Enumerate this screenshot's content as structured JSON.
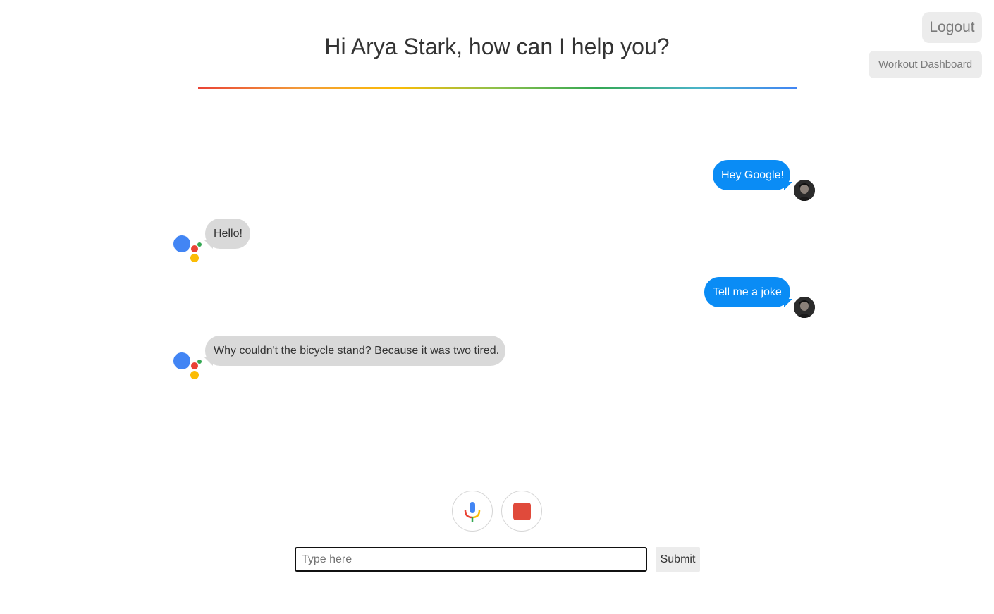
{
  "header": {
    "greeting": "Hi Arya Stark, how can I help you?",
    "logout_label": "Logout",
    "dashboard_label": "Workout Dashboard"
  },
  "messages": [
    {
      "sender": "user",
      "text": "Hey Google!"
    },
    {
      "sender": "assistant",
      "text": "Hello!"
    },
    {
      "sender": "user",
      "text": "Tell me a joke"
    },
    {
      "sender": "assistant",
      "text": "Why couldn't the bicycle stand? Because it was two tired."
    }
  ],
  "controls": {
    "mic_icon": "microphone-icon",
    "stop_icon": "stop-icon"
  },
  "input": {
    "placeholder": "Type here",
    "value": "",
    "submit_label": "Submit"
  },
  "colors": {
    "user_bubble": "#0a8cf5",
    "assistant_bubble": "#d9d9d9",
    "stop": "#e04a3b",
    "google_blue": "#4285f4",
    "google_red": "#ea4335",
    "google_yellow": "#fbbc05",
    "google_green": "#34a853"
  }
}
